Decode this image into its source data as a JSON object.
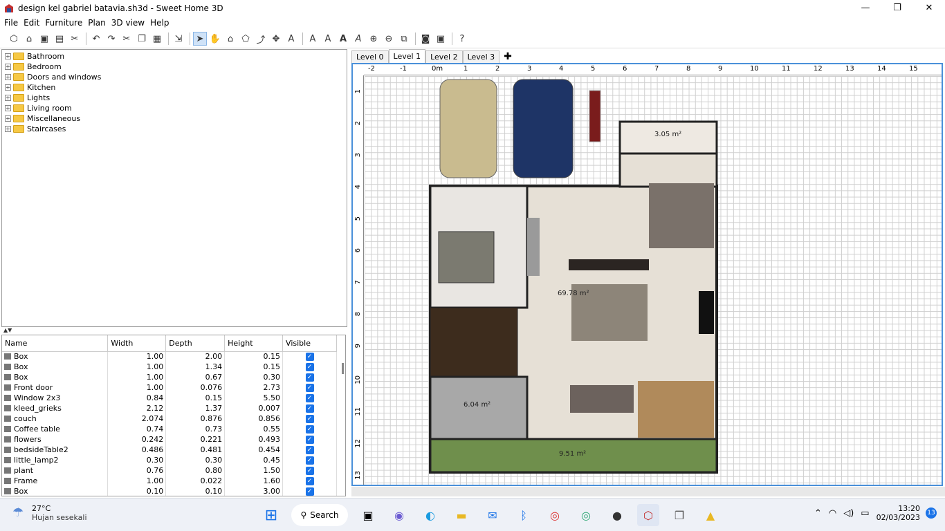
{
  "window": {
    "title": "design kel gabriel batavia.sh3d - Sweet Home 3D",
    "minimize": "—",
    "restore": "❐",
    "close": "✕"
  },
  "menu": [
    "File",
    "Edit",
    "Furniture",
    "Plan",
    "3D view",
    "Help"
  ],
  "catalog": [
    "Bathroom",
    "Bedroom",
    "Doors and windows",
    "Kitchen",
    "Lights",
    "Living room",
    "Miscellaneous",
    "Staircases"
  ],
  "table": {
    "headers": [
      "Name",
      "Width",
      "Depth",
      "Height",
      "Visible"
    ],
    "rows": [
      {
        "name": "Box",
        "width": "1.00",
        "depth": "2.00",
        "height": "0.15"
      },
      {
        "name": "Box",
        "width": "1.00",
        "depth": "1.34",
        "height": "0.15"
      },
      {
        "name": "Box",
        "width": "1.00",
        "depth": "0.67",
        "height": "0.30"
      },
      {
        "name": "Front door",
        "width": "1.00",
        "depth": "0.076",
        "height": "2.73"
      },
      {
        "name": "Window 2x3",
        "width": "0.84",
        "depth": "0.15",
        "height": "5.50"
      },
      {
        "name": "kleed_grieks",
        "width": "2.12",
        "depth": "1.37",
        "height": "0.007"
      },
      {
        "name": "couch",
        "width": "2.074",
        "depth": "0.876",
        "height": "0.856"
      },
      {
        "name": "Coffee table",
        "width": "0.74",
        "depth": "0.73",
        "height": "0.55"
      },
      {
        "name": "flowers",
        "width": "0.242",
        "depth": "0.221",
        "height": "0.493"
      },
      {
        "name": "bedsideTable2",
        "width": "0.486",
        "depth": "0.481",
        "height": "0.454"
      },
      {
        "name": "little_lamp2",
        "width": "0.30",
        "depth": "0.30",
        "height": "0.45"
      },
      {
        "name": "plant",
        "width": "0.76",
        "depth": "0.80",
        "height": "1.50"
      },
      {
        "name": "Frame",
        "width": "1.00",
        "depth": "0.022",
        "height": "1.60"
      },
      {
        "name": "Box",
        "width": "0.10",
        "depth": "0.10",
        "height": "3.00"
      }
    ]
  },
  "levels": [
    "Level 0",
    "Level 1",
    "Level 2",
    "Level 3"
  ],
  "levels_add": "✚",
  "ruler_h": [
    "-2",
    "-1",
    "0m",
    "1",
    "2",
    "3",
    "4",
    "5",
    "6",
    "7",
    "8",
    "9",
    "10",
    "11",
    "12",
    "13",
    "14",
    "15"
  ],
  "ruler_v": [
    "1",
    "2",
    "3",
    "4",
    "5",
    "6",
    "7",
    "8",
    "9",
    "10",
    "11",
    "12",
    "13"
  ],
  "rooms": {
    "small": "3.05 m²",
    "main": "69.78 m²",
    "bath": "6.04 m²",
    "garden": "9.51 m²"
  },
  "taskbar": {
    "temp": "27°C",
    "weather": "Hujan sesekali",
    "search": "Search",
    "time": "13:20",
    "date": "02/03/2023",
    "notifications": "13"
  }
}
